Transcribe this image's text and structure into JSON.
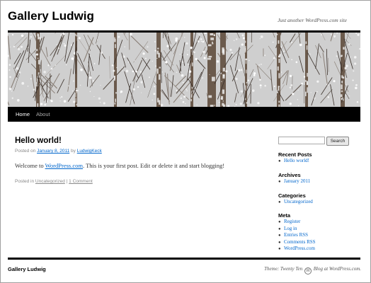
{
  "site": {
    "title": "Gallery Ludwig",
    "tagline": "Just another WordPress.com site"
  },
  "nav": {
    "items": [
      {
        "label": "Home"
      },
      {
        "label": "About"
      }
    ]
  },
  "post": {
    "title": "Hello world!",
    "meta_prefix": "Posted on ",
    "date": "January 8, 2011",
    "meta_by": " by ",
    "author": "LudwigKeck",
    "content_prefix": "Welcome to ",
    "content_link": "WordPress.com",
    "content_suffix": ". This is your first post. Edit or delete it and start blogging!",
    "posted_in": "Posted in ",
    "category": "Uncategorized",
    "separator": " | ",
    "comments": "1 Comment"
  },
  "sidebar": {
    "search_button": "Search",
    "search_value": "",
    "recent_posts": {
      "title": "Recent Posts",
      "items": [
        "Hello world!"
      ]
    },
    "archives": {
      "title": "Archives",
      "items": [
        "January 2011"
      ]
    },
    "categories": {
      "title": "Categories",
      "items": [
        "Uncategorized"
      ]
    },
    "meta": {
      "title": "Meta",
      "items": [
        "Register",
        "Log in",
        "Entries RSS",
        "Comments RSS",
        "WordPress.com"
      ]
    }
  },
  "footer": {
    "title": "Gallery Ludwig",
    "theme_text": "Theme: Twenty Ten",
    "blog_text": "Blog at WordPress.com."
  },
  "colors": {
    "link": "#0066cc",
    "nav_bg": "#000000",
    "rule": "#000000"
  }
}
